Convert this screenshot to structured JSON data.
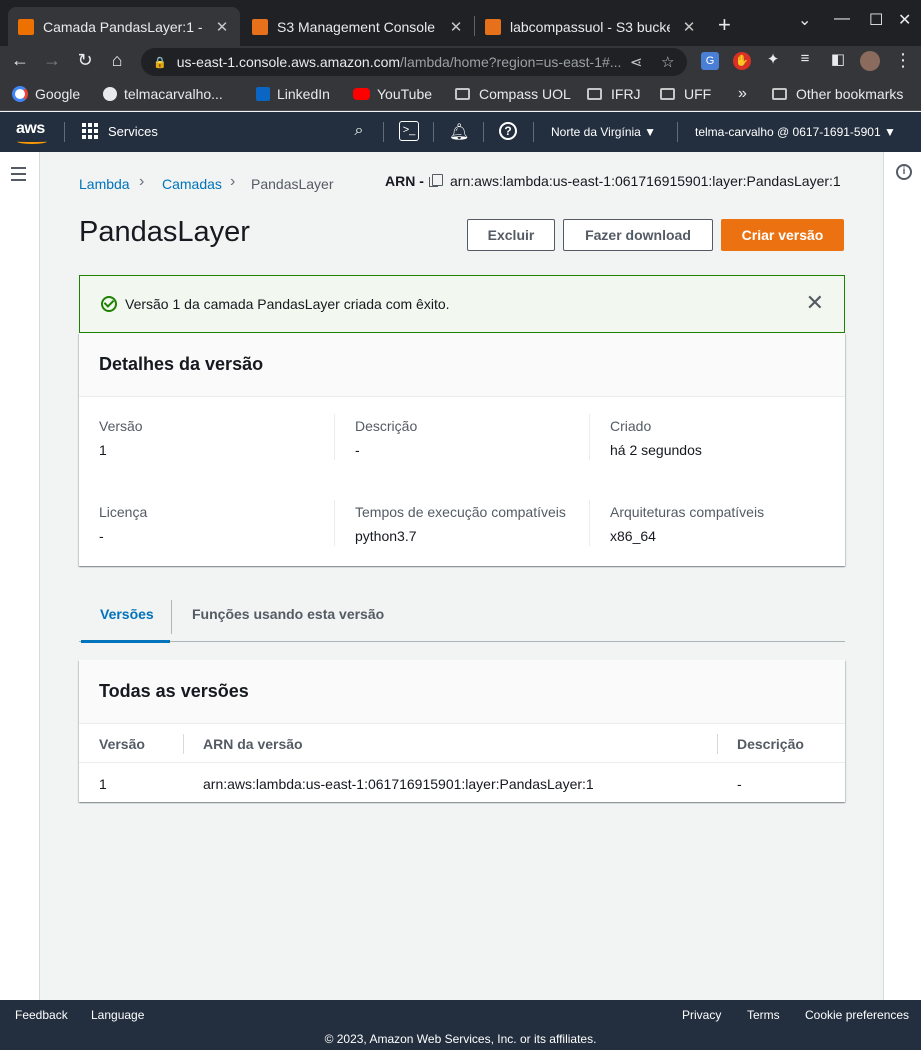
{
  "browser": {
    "tabs": [
      {
        "label": "Camada PandasLayer:1 -",
        "active": true,
        "icon": "aws-lambda-icon",
        "color": "#ed7100"
      },
      {
        "label": "S3 Management Console",
        "active": false,
        "icon": "aws-s3-icon",
        "color": "#e7711b"
      },
      {
        "label": "labcompassuol - S3 bucke",
        "active": false,
        "icon": "aws-s3-icon",
        "color": "#e7711b"
      }
    ],
    "url_host": "us-east-1.console.aws.amazon.com",
    "url_path": "/lambda/home?region=us-east-1#...",
    "bookmarks": [
      {
        "label": "Google",
        "icon": "google-icon"
      },
      {
        "label": "telmacarvalho...",
        "icon": "github-icon"
      },
      {
        "label": "LinkedIn",
        "icon": "linkedin-icon"
      },
      {
        "label": "YouTube",
        "icon": "youtube-icon"
      },
      {
        "label": "Compass UOL",
        "icon": "folder-icon"
      },
      {
        "label": "IFRJ",
        "icon": "folder-icon"
      },
      {
        "label": "UFF",
        "icon": "folder-icon"
      }
    ],
    "overflow_label": "»",
    "other_bookmarks": "Other bookmarks"
  },
  "aws_nav": {
    "logo": "aws",
    "services": "Services",
    "region": "Norte da Virgínia ▼",
    "account": "telma-carvalho @ 0617-1691-5901 ▼"
  },
  "breadcrumb": {
    "items": [
      "Lambda",
      "Camadas",
      "PandasLayer"
    ],
    "arn_label": "ARN -",
    "arn_value": "arn:aws:lambda:us-east-1:061716915901:layer:PandasLayer:1"
  },
  "page": {
    "title": "PandasLayer",
    "buttons": {
      "delete": "Excluir",
      "download": "Fazer download",
      "create": "Criar versão"
    }
  },
  "flash": {
    "message": "Versão 1 da camada PandasLayer criada com êxito."
  },
  "details": {
    "title": "Detalhes da versão",
    "fields": [
      {
        "key": "Versão",
        "value": "1"
      },
      {
        "key": "Descrição",
        "value": "-"
      },
      {
        "key": "Criado",
        "value": "há 2 segundos"
      },
      {
        "key": "Licença",
        "value": "-"
      },
      {
        "key": "Tempos de execução compatíveis",
        "value": "python3.7"
      },
      {
        "key": "Arquiteturas compatíveis",
        "value": "x86_64"
      }
    ]
  },
  "tabs": {
    "versions": "Versões",
    "functions": "Funções usando esta versão"
  },
  "versions_table": {
    "title": "Todas as versões",
    "columns": [
      "Versão",
      "ARN da versão",
      "Descrição"
    ],
    "rows": [
      [
        "1",
        "arn:aws:lambda:us-east-1:061716915901:layer:PandasLayer:1",
        "-"
      ]
    ]
  },
  "footer": {
    "feedback": "Feedback",
    "language": "Language",
    "privacy": "Privacy",
    "terms": "Terms",
    "cookies": "Cookie preferences",
    "copyright": "© 2023, Amazon Web Services, Inc. or its affiliates."
  },
  "colors": {
    "accent": "#ec7211",
    "link": "#0073bb",
    "success": "#1d8102",
    "nav_bg": "#232f3e"
  }
}
